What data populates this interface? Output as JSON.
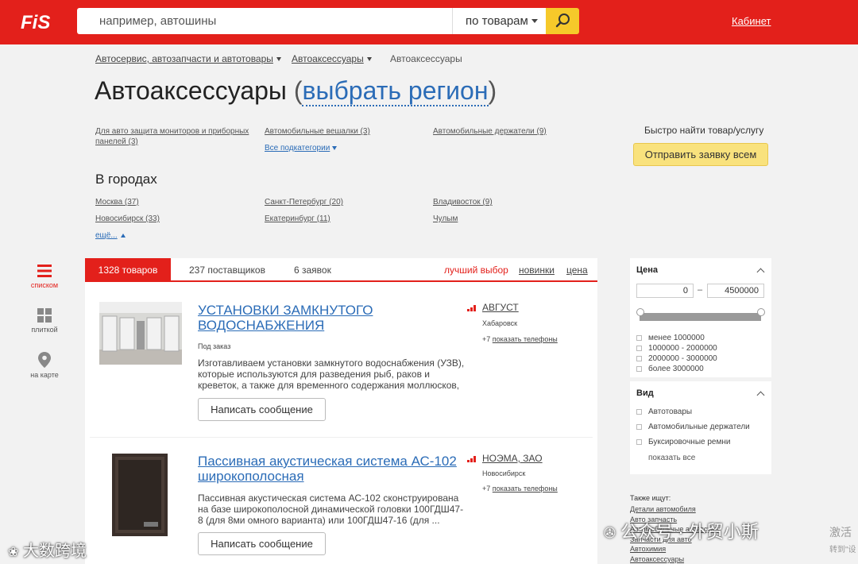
{
  "header": {
    "logo_text": "FiS",
    "search_placeholder": "например, автошины",
    "scope_label": "по товарам",
    "cabinet_label": "Кабинет",
    "colors": {
      "brand": "#e3201b",
      "search_button": "#f6c92a"
    }
  },
  "breadcrumbs": [
    {
      "label": "Автосервис, автозапчасти и автотовары"
    },
    {
      "label": "Автоаксессуары"
    },
    {
      "label": "Автоаксессуары"
    }
  ],
  "page": {
    "title": "Автоаксессуары",
    "region_paren_open": "(",
    "region_link": "выбрать регион",
    "region_paren_close": ")"
  },
  "subcategories": [
    {
      "label": "Для авто защита мониторов и приборных панелей (3)"
    },
    {
      "label": "Автомобильные вешалки (3)"
    },
    {
      "label": "Автомобильные держатели (9)"
    }
  ],
  "all_subcategories_label": "Все подкатегории",
  "quick": {
    "label": "Быстро найти товар/услугу",
    "button": "Отправить заявку всем"
  },
  "cities": {
    "title": "В городах",
    "items": [
      {
        "label": "Москва (37)"
      },
      {
        "label": "Санкт-Петербург (20)"
      },
      {
        "label": "Владивосток (9)"
      },
      {
        "label": "Новосибирск (33)"
      },
      {
        "label": "Екатеринбург (11)"
      },
      {
        "label": "Чулым"
      }
    ],
    "more_label": "ещё..."
  },
  "view_modes": [
    {
      "label": "списком",
      "icon": "list-icon"
    },
    {
      "label": "плиткой",
      "icon": "grid-icon"
    },
    {
      "label": "на карте",
      "icon": "map-pin-icon"
    }
  ],
  "tabs": [
    {
      "label": "1328 товаров"
    },
    {
      "label": "237 поставщиков"
    },
    {
      "label": "6 заявок"
    }
  ],
  "sort": {
    "best": "лучший выбор",
    "new": "новинки",
    "price": "цена"
  },
  "products": [
    {
      "title": "УСТАНОВКИ ЗАМКНУТОГО ВОДОСНАБЖЕНИЯ",
      "note": "Под заказ",
      "description": "Изготавливаем установки замкнутого водоснабжения (УЗВ), которые используются для разведения рыб, раков и креветок, а также для временного содержания моллюсков, ...",
      "button": "Написать сообщение",
      "vendor": "АВГУСТ",
      "city": "Хабаровск",
      "phones_count": "+7",
      "phones_link": "показать телефоны"
    },
    {
      "title": "Пассивная акустическая система АС-102 широкополосная",
      "note": "",
      "description": "Пассивная акустическая система АС-102 сконструирована на базе широкополосной динамической головки 100ГДШ47-8 (для 8ми омного варианта) или 100ГДШ47-16 (для ...",
      "button": "Написать сообщение",
      "vendor": "НОЭМА, ЗАО",
      "city": "Новосибирск",
      "phones_count": "+7",
      "phones_link": "показать телефоны"
    }
  ],
  "filters": {
    "price": {
      "title": "Цена",
      "min": "0",
      "dash": "–",
      "max": "4500000",
      "options": [
        {
          "label": "менее 1000000"
        },
        {
          "label": "1000000 - 2000000"
        },
        {
          "label": "2000000 - 3000000"
        },
        {
          "label": "более 3000000"
        }
      ]
    },
    "kind": {
      "title": "Вид",
      "options": [
        {
          "label": "Автотовары"
        },
        {
          "label": "Автомобильные держатели"
        },
        {
          "label": "Буксировочные ремни"
        }
      ],
      "show_all": "показать все"
    }
  },
  "also_search": {
    "title": "Также ищут:",
    "links": [
      {
        "label": "Детали автомобиля"
      },
      {
        "label": "Авто запчасть"
      },
      {
        "label": "Автомобильные аксессуар"
      },
      {
        "label": "Запчасти для авто"
      },
      {
        "label": "Автохимия"
      },
      {
        "label": "Автоаксессуары"
      }
    ]
  },
  "watermarks": {
    "left": "大数跨境",
    "right": "公众号 · 外贸小斯",
    "right_extra": "激活",
    "right_extra2": "转到\"设"
  }
}
